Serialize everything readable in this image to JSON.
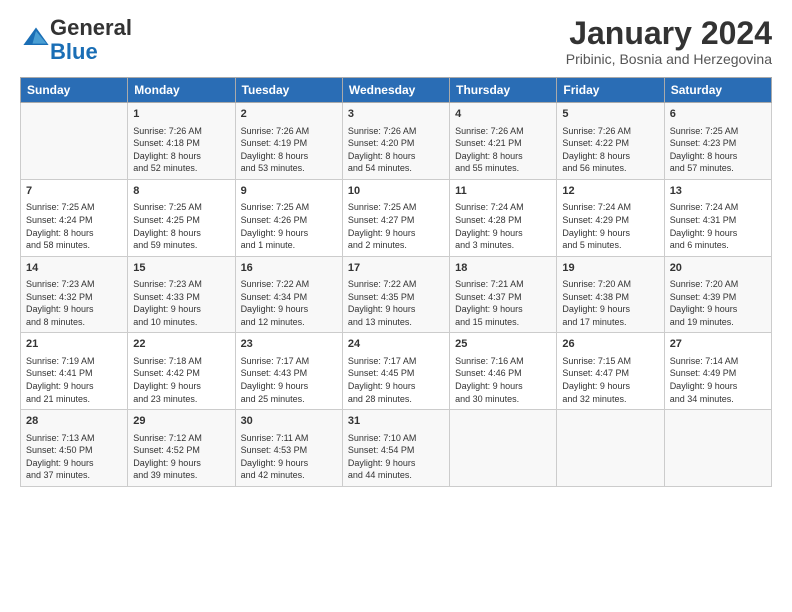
{
  "logo": {
    "general": "General",
    "blue": "Blue"
  },
  "header": {
    "month": "January 2024",
    "location": "Pribinic, Bosnia and Herzegovina"
  },
  "weekdays": [
    "Sunday",
    "Monday",
    "Tuesday",
    "Wednesday",
    "Thursday",
    "Friday",
    "Saturday"
  ],
  "weeks": [
    [
      {
        "day": "",
        "content": ""
      },
      {
        "day": "1",
        "content": "Sunrise: 7:26 AM\nSunset: 4:18 PM\nDaylight: 8 hours\nand 52 minutes."
      },
      {
        "day": "2",
        "content": "Sunrise: 7:26 AM\nSunset: 4:19 PM\nDaylight: 8 hours\nand 53 minutes."
      },
      {
        "day": "3",
        "content": "Sunrise: 7:26 AM\nSunset: 4:20 PM\nDaylight: 8 hours\nand 54 minutes."
      },
      {
        "day": "4",
        "content": "Sunrise: 7:26 AM\nSunset: 4:21 PM\nDaylight: 8 hours\nand 55 minutes."
      },
      {
        "day": "5",
        "content": "Sunrise: 7:26 AM\nSunset: 4:22 PM\nDaylight: 8 hours\nand 56 minutes."
      },
      {
        "day": "6",
        "content": "Sunrise: 7:25 AM\nSunset: 4:23 PM\nDaylight: 8 hours\nand 57 minutes."
      }
    ],
    [
      {
        "day": "7",
        "content": "Sunrise: 7:25 AM\nSunset: 4:24 PM\nDaylight: 8 hours\nand 58 minutes."
      },
      {
        "day": "8",
        "content": "Sunrise: 7:25 AM\nSunset: 4:25 PM\nDaylight: 8 hours\nand 59 minutes."
      },
      {
        "day": "9",
        "content": "Sunrise: 7:25 AM\nSunset: 4:26 PM\nDaylight: 9 hours\nand 1 minute."
      },
      {
        "day": "10",
        "content": "Sunrise: 7:25 AM\nSunset: 4:27 PM\nDaylight: 9 hours\nand 2 minutes."
      },
      {
        "day": "11",
        "content": "Sunrise: 7:24 AM\nSunset: 4:28 PM\nDaylight: 9 hours\nand 3 minutes."
      },
      {
        "day": "12",
        "content": "Sunrise: 7:24 AM\nSunset: 4:29 PM\nDaylight: 9 hours\nand 5 minutes."
      },
      {
        "day": "13",
        "content": "Sunrise: 7:24 AM\nSunset: 4:31 PM\nDaylight: 9 hours\nand 6 minutes."
      }
    ],
    [
      {
        "day": "14",
        "content": "Sunrise: 7:23 AM\nSunset: 4:32 PM\nDaylight: 9 hours\nand 8 minutes."
      },
      {
        "day": "15",
        "content": "Sunrise: 7:23 AM\nSunset: 4:33 PM\nDaylight: 9 hours\nand 10 minutes."
      },
      {
        "day": "16",
        "content": "Sunrise: 7:22 AM\nSunset: 4:34 PM\nDaylight: 9 hours\nand 12 minutes."
      },
      {
        "day": "17",
        "content": "Sunrise: 7:22 AM\nSunset: 4:35 PM\nDaylight: 9 hours\nand 13 minutes."
      },
      {
        "day": "18",
        "content": "Sunrise: 7:21 AM\nSunset: 4:37 PM\nDaylight: 9 hours\nand 15 minutes."
      },
      {
        "day": "19",
        "content": "Sunrise: 7:20 AM\nSunset: 4:38 PM\nDaylight: 9 hours\nand 17 minutes."
      },
      {
        "day": "20",
        "content": "Sunrise: 7:20 AM\nSunset: 4:39 PM\nDaylight: 9 hours\nand 19 minutes."
      }
    ],
    [
      {
        "day": "21",
        "content": "Sunrise: 7:19 AM\nSunset: 4:41 PM\nDaylight: 9 hours\nand 21 minutes."
      },
      {
        "day": "22",
        "content": "Sunrise: 7:18 AM\nSunset: 4:42 PM\nDaylight: 9 hours\nand 23 minutes."
      },
      {
        "day": "23",
        "content": "Sunrise: 7:17 AM\nSunset: 4:43 PM\nDaylight: 9 hours\nand 25 minutes."
      },
      {
        "day": "24",
        "content": "Sunrise: 7:17 AM\nSunset: 4:45 PM\nDaylight: 9 hours\nand 28 minutes."
      },
      {
        "day": "25",
        "content": "Sunrise: 7:16 AM\nSunset: 4:46 PM\nDaylight: 9 hours\nand 30 minutes."
      },
      {
        "day": "26",
        "content": "Sunrise: 7:15 AM\nSunset: 4:47 PM\nDaylight: 9 hours\nand 32 minutes."
      },
      {
        "day": "27",
        "content": "Sunrise: 7:14 AM\nSunset: 4:49 PM\nDaylight: 9 hours\nand 34 minutes."
      }
    ],
    [
      {
        "day": "28",
        "content": "Sunrise: 7:13 AM\nSunset: 4:50 PM\nDaylight: 9 hours\nand 37 minutes."
      },
      {
        "day": "29",
        "content": "Sunrise: 7:12 AM\nSunset: 4:52 PM\nDaylight: 9 hours\nand 39 minutes."
      },
      {
        "day": "30",
        "content": "Sunrise: 7:11 AM\nSunset: 4:53 PM\nDaylight: 9 hours\nand 42 minutes."
      },
      {
        "day": "31",
        "content": "Sunrise: 7:10 AM\nSunset: 4:54 PM\nDaylight: 9 hours\nand 44 minutes."
      },
      {
        "day": "",
        "content": ""
      },
      {
        "day": "",
        "content": ""
      },
      {
        "day": "",
        "content": ""
      }
    ]
  ]
}
